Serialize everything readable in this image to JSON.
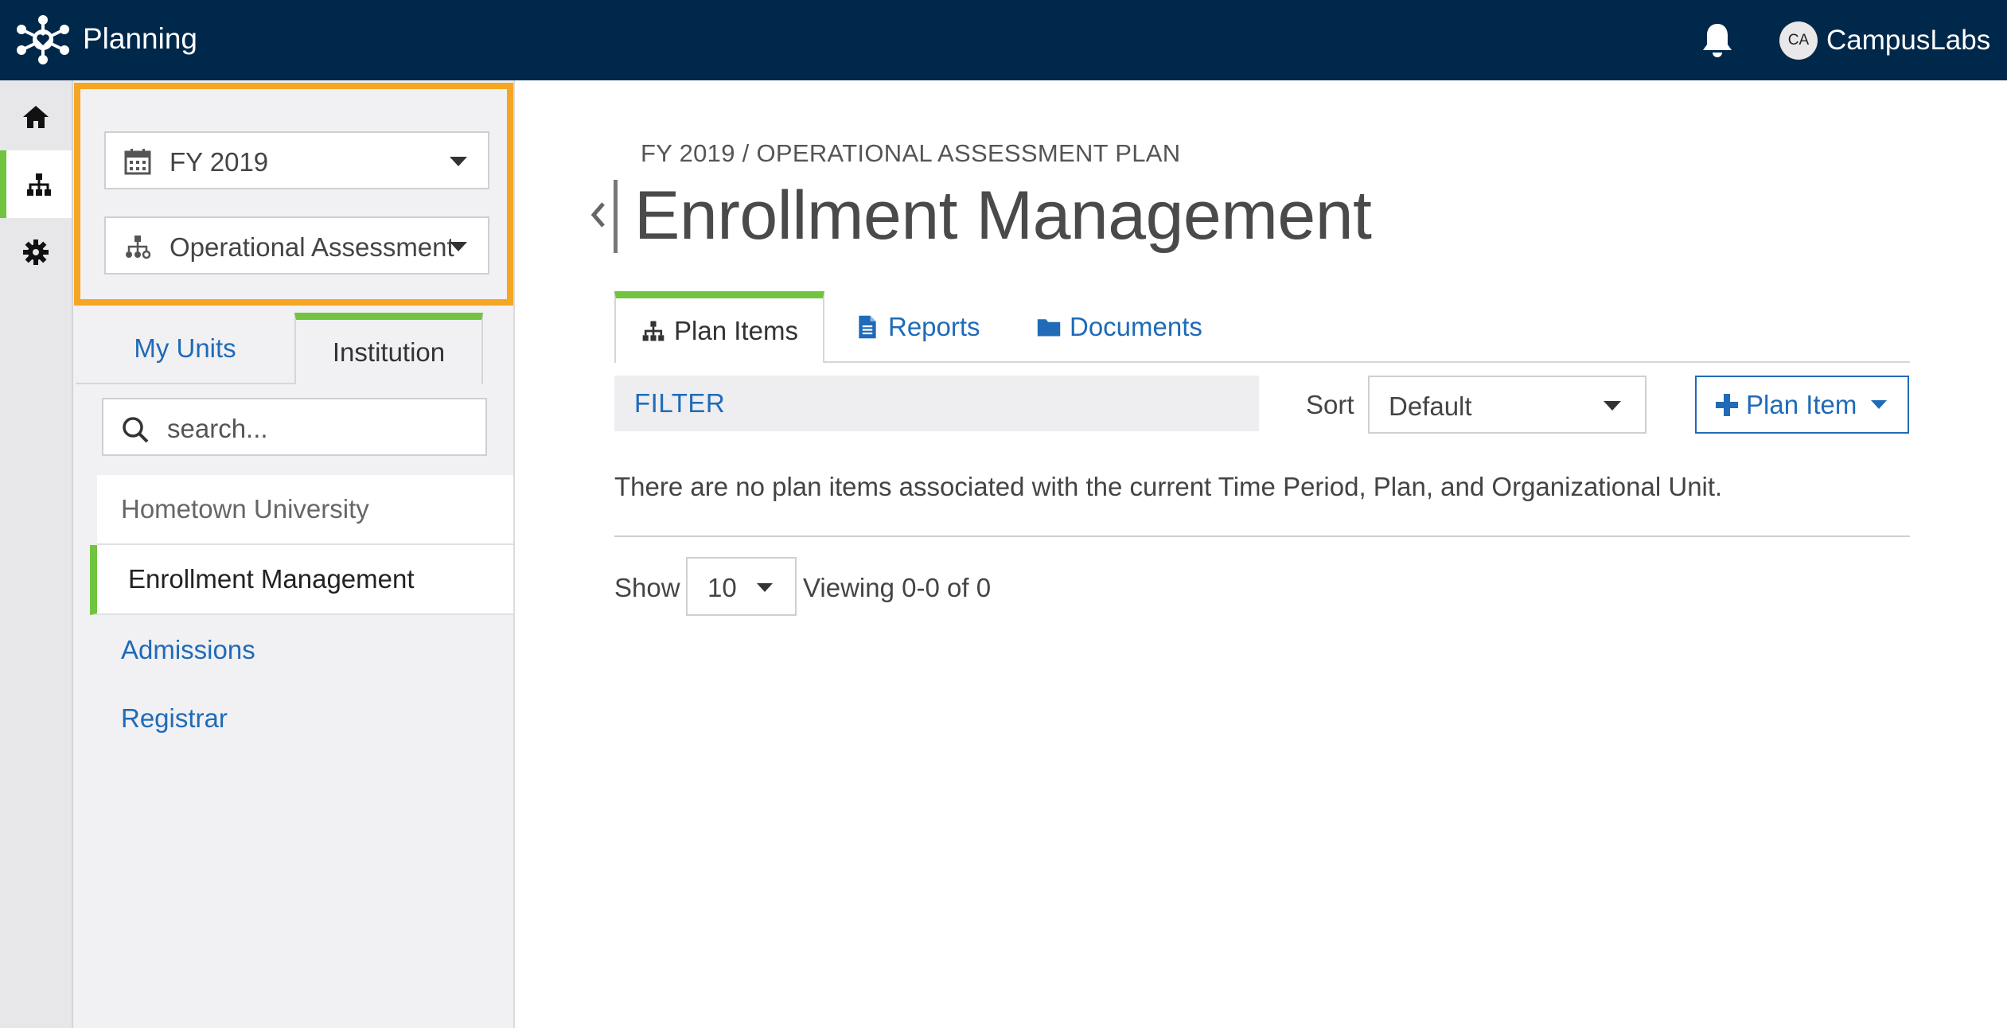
{
  "header": {
    "app_title": "Planning",
    "user_initials": "CA",
    "user_name": "CampusLabs",
    "logo_icon": "network-heart-icon",
    "notification_icon": "bell-icon"
  },
  "rail": {
    "items": [
      {
        "icon": "home-icon"
      },
      {
        "icon": "org-chart-icon",
        "active": true
      },
      {
        "icon": "gear-icon"
      }
    ]
  },
  "sidebar": {
    "period_select": "FY 2019",
    "plan_select": "Operational Assessment Plan",
    "tabs": [
      "My Units",
      "Institution"
    ],
    "active_tab": "Institution",
    "search_placeholder": "search...",
    "units": [
      {
        "label": "Hometown University"
      },
      {
        "label": "Enrollment Management",
        "active": true
      },
      {
        "label": "Admissions"
      },
      {
        "label": "Registrar"
      }
    ]
  },
  "main": {
    "breadcrumb": "FY 2019 / OPERATIONAL ASSESSMENT PLAN",
    "title": "Enrollment Management",
    "tabs": [
      "Plan Items",
      "Reports",
      "Documents"
    ],
    "active_tab": "Plan Items",
    "filter_label": "FILTER",
    "sort_label": "Sort",
    "sort_value": "Default",
    "add_button_label": "Plan Item",
    "empty_message": "There are no plan items associated with the current Time Period, Plan, and Organizational Unit.",
    "show_label": "Show",
    "page_size": "10",
    "viewing_text": "Viewing 0-0 of 0"
  },
  "colors": {
    "header_bg": "#00284a",
    "accent_green": "#71c43f",
    "highlight_orange": "#f5a623",
    "link_blue": "#1f6bb8"
  }
}
